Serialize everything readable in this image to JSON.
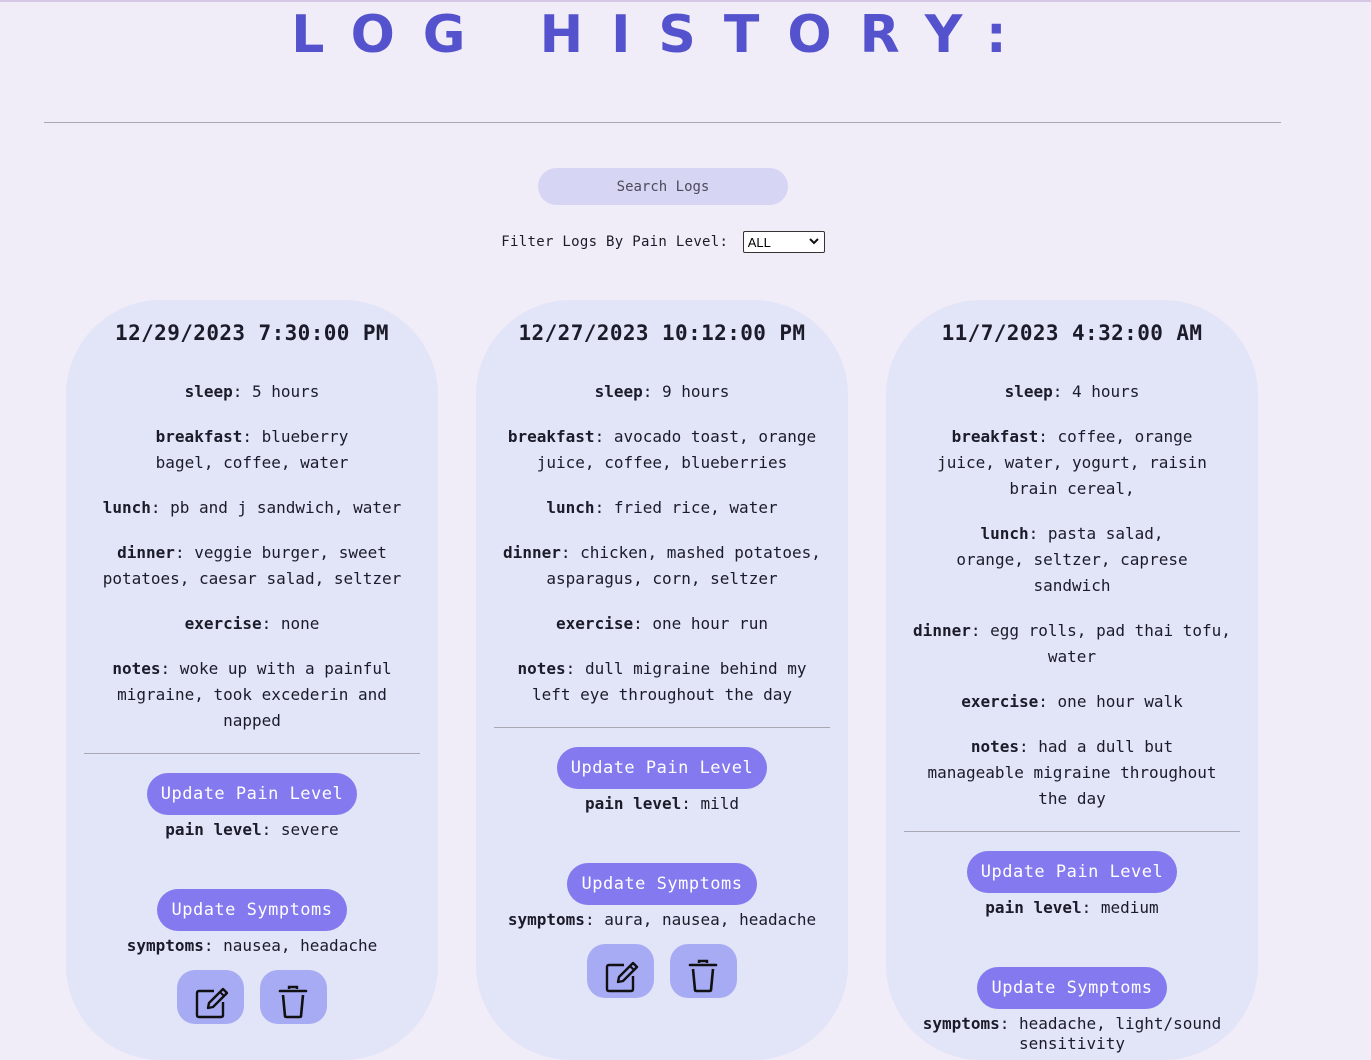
{
  "header": {
    "title": "LOG HISTORY:"
  },
  "search": {
    "placeholder": "Search Logs"
  },
  "filter": {
    "label": "Filter Logs By Pain Level:",
    "selected": "ALL"
  },
  "labels": {
    "sleep": "sleep",
    "breakfast": "breakfast",
    "lunch": "lunch",
    "dinner": "dinner",
    "exercise": "exercise",
    "notes": "notes",
    "pain_level": "pain level",
    "symptoms": "symptoms",
    "update_pain": "Update Pain Level",
    "update_symptoms": "Update Symptoms"
  },
  "logs": [
    {
      "date": "12/29/2023 7:30:00 PM",
      "sleep": "5 hours",
      "breakfast": "blueberry bagel, coffee, water",
      "lunch": "pb and j sandwich, water",
      "dinner": "veggie burger, sweet potatoes, caesar salad, seltzer",
      "exercise": "none",
      "notes": "woke up with a painful migraine, took excederin and napped",
      "pain_level": "severe",
      "symptoms": "nausea, headache"
    },
    {
      "date": "12/27/2023 10:12:00 PM",
      "sleep": "9 hours",
      "breakfast": "avocado toast, orange juice, coffee, blueberries",
      "lunch": "fried rice, water",
      "dinner": "chicken, mashed potatoes, asparagus, corn, seltzer",
      "exercise": "one hour run",
      "notes": "dull migraine behind my left eye throughout the day",
      "pain_level": "mild",
      "symptoms": "aura, nausea, headache"
    },
    {
      "date": "11/7/2023 4:32:00 AM",
      "sleep": "4 hours",
      "breakfast": "coffee, orange juice, water, yogurt, raisin brain cereal,",
      "lunch": "pasta salad, orange, seltzer, caprese sandwich",
      "dinner": "egg rolls, pad thai tofu, water",
      "exercise": "one hour walk",
      "notes": "had a dull but manageable migraine throughout the day",
      "pain_level": "medium",
      "symptoms": "headache, light/sound sensitivity"
    }
  ]
}
